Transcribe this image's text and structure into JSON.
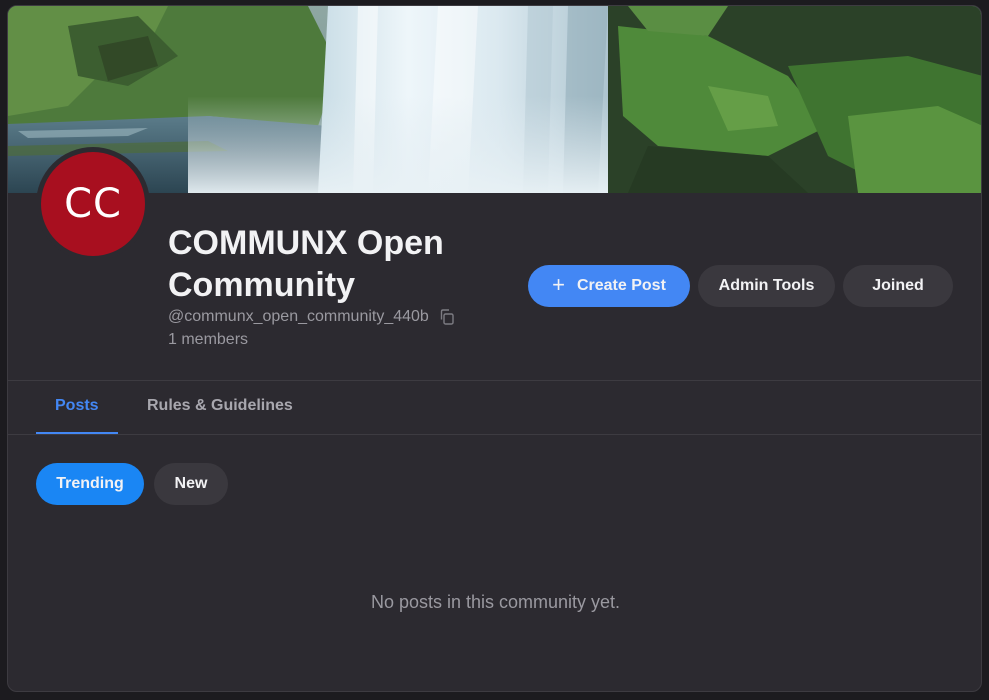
{
  "community": {
    "avatar_initials": "CC",
    "avatar_color": "#a80f1f",
    "name": "COMMUNX Open Community",
    "handle": "@communx_open_community_440b",
    "members": "1 members"
  },
  "actions": {
    "create_post_label": "Create Post",
    "create_post_icon": "plus-icon",
    "admin_tools_label": "Admin Tools",
    "joined_label": "Joined"
  },
  "tabs": [
    {
      "label": "Posts",
      "active": true
    },
    {
      "label": "Rules & Guidelines",
      "active": false
    }
  ],
  "sort": [
    {
      "label": "Trending",
      "active": true
    },
    {
      "label": "New",
      "active": false
    }
  ],
  "feed": {
    "empty_message": "No posts in this community yet."
  },
  "colors": {
    "accent": "#4387f4",
    "trending": "#1a86f4",
    "surface": "#2c2a30",
    "background": "#1c1b1f"
  }
}
